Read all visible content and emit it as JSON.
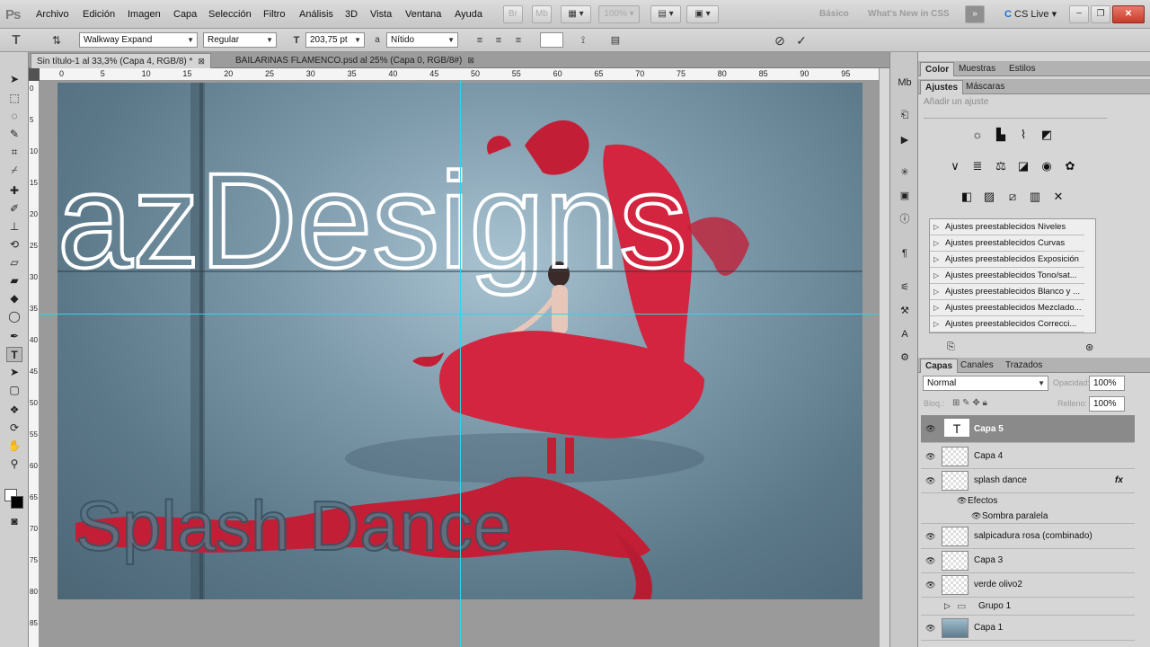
{
  "app": {
    "logo": "Ps"
  },
  "menubar": {
    "items": [
      "Archivo",
      "Edición",
      "Imagen",
      "Capa",
      "Selección",
      "Filtro",
      "Análisis",
      "3D",
      "Vista",
      "Ventana",
      "Ayuda"
    ],
    "zoom": "100%",
    "workspaces": [
      "Básico",
      "What's New in CSS"
    ],
    "cs_live": "CS Live"
  },
  "options": {
    "font_family": "Walkway Expand",
    "font_style": "Regular",
    "font_size": "203,75 pt",
    "aa_label": "a",
    "antialias": "Nítido"
  },
  "tabs": [
    {
      "label": "Sin título-1 al 33,3% (Capa 4, RGB/8) *",
      "active": true
    },
    {
      "label": "BAILARINAS FLAMENCO.psd al 25% (Capa 0, RGB/8#)",
      "active": false
    }
  ],
  "ruler": {
    "top": [
      "0",
      "5",
      "10",
      "15",
      "20",
      "25",
      "30",
      "35",
      "40",
      "45",
      "50",
      "55",
      "60",
      "65",
      "70",
      "75",
      "80",
      "85",
      "90",
      "95",
      "100"
    ],
    "left": [
      "0",
      "5",
      "10",
      "15",
      "20",
      "25",
      "30",
      "35",
      "40",
      "45",
      "50",
      "55",
      "60",
      "65",
      "70",
      "75",
      "80",
      "85"
    ]
  },
  "canvas": {
    "headline": "azDesigns",
    "bottom_text": "Splash Dance",
    "colors": {
      "background": "#6f8c9c",
      "red": "#d0253d",
      "guide": "#2fd6e6"
    }
  },
  "panels": {
    "top_tabs": [
      "Color",
      "Muestras",
      "Estilos"
    ],
    "adj_tabs": [
      "Ajustes",
      "Máscaras"
    ],
    "adj_hint": "Añadir un ajuste",
    "adj_icons": {
      "row1": [
        "brightness-icon",
        "levels-icon",
        "curves-icon",
        "exposure-icon"
      ],
      "row2": [
        "vibrance-icon",
        "hue-saturation-icon",
        "color-balance-icon",
        "black-white-icon",
        "photo-filter-icon",
        "channel-mixer-icon"
      ],
      "row3": [
        "invert-icon",
        "posterize-icon",
        "threshold-icon",
        "gradient-map-icon",
        "selective-color-icon"
      ]
    },
    "presets": [
      "Ajustes preestablecidos Niveles",
      "Ajustes preestablecidos Curvas",
      "Ajustes preestablecidos Exposición",
      "Ajustes preestablecidos Tono/sat...",
      "Ajustes preestablecidos Blanco y ...",
      "Ajustes preestablecidos Mezclado...",
      "Ajustes preestablecidos Correcci..."
    ],
    "layers_tabs": [
      "Capas",
      "Canales",
      "Trazados"
    ],
    "blend_mode": "Normal",
    "opacity_label": "Opacidad:",
    "opacity": "100%",
    "lock_label": "Bloq.:",
    "fill_label": "Relleno:",
    "fill": "100%",
    "layers": [
      {
        "name": "Capa 5",
        "selected": true,
        "type": "text",
        "visible": true
      },
      {
        "name": "Capa 4",
        "selected": false,
        "type": "normal",
        "visible": true
      },
      {
        "name": "splash dance",
        "selected": false,
        "type": "normal",
        "fx": "fx",
        "visible": true
      },
      {
        "name": "Efectos",
        "selected": false,
        "type": "effects",
        "visible": true
      },
      {
        "name": "Sombra paralela",
        "selected": false,
        "type": "effect",
        "visible": true
      },
      {
        "name": "salpicadura rosa (combinado)",
        "selected": false,
        "type": "normal",
        "visible": true
      },
      {
        "name": "Capa 3",
        "selected": false,
        "type": "normal",
        "visible": true
      },
      {
        "name": "verde olivo2",
        "selected": false,
        "type": "normal",
        "visible": true
      },
      {
        "name": "Grupo 1",
        "selected": false,
        "type": "group",
        "visible": false
      },
      {
        "name": "Capa 1",
        "selected": false,
        "type": "fill",
        "visible": true
      }
    ]
  }
}
